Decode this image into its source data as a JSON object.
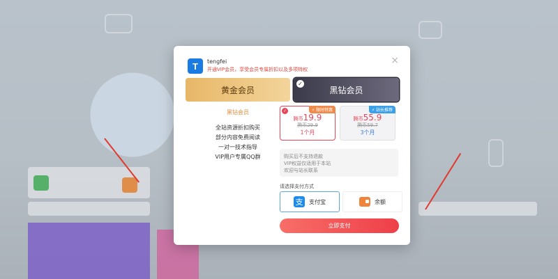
{
  "modal": {
    "username": "tengfei",
    "subtitle": "开通VIP会员，享受会员专属折扣以及多项特权",
    "logo_letter": "T",
    "close_glyph": "×",
    "tabs": [
      {
        "label": "黄金会员",
        "selected": false
      },
      {
        "label": "黑钻会员",
        "selected": true
      }
    ],
    "benefits": {
      "title": "黑钻会员",
      "items": [
        "全站资源折扣购买",
        "部分内容免费阅读",
        "一对一技术指导",
        "VIP用户专属QQ群"
      ]
    },
    "plans": [
      {
        "badge": "⚡ 限时特惠",
        "currency": "腾币",
        "price": "19.9",
        "original": "腾币29.9",
        "duration": "1个月",
        "selected": true
      },
      {
        "badge": "⚡ 站长推荐",
        "currency": "腾币",
        "price": "55.9",
        "original": "腾币59.7",
        "duration": "3个月",
        "selected": false
      }
    ],
    "notice": [
      "购买后不支持退款",
      "VIP权益仅适用于本站",
      "欢迎与站长联系"
    ],
    "payment_label": "请选择支付方式",
    "payment_methods": [
      {
        "label": "支付宝",
        "icon": "alipay-icon",
        "icon_glyph": "支",
        "selected": true
      },
      {
        "label": "余额",
        "icon": "wallet-icon",
        "selected": false
      }
    ],
    "pay_button": "立即支付"
  },
  "colors": {
    "accent_red": "#ee3f49",
    "gold": "#e7b768",
    "black_diamond": "#3b3a4a",
    "alipay_blue": "#1d8ce8"
  }
}
